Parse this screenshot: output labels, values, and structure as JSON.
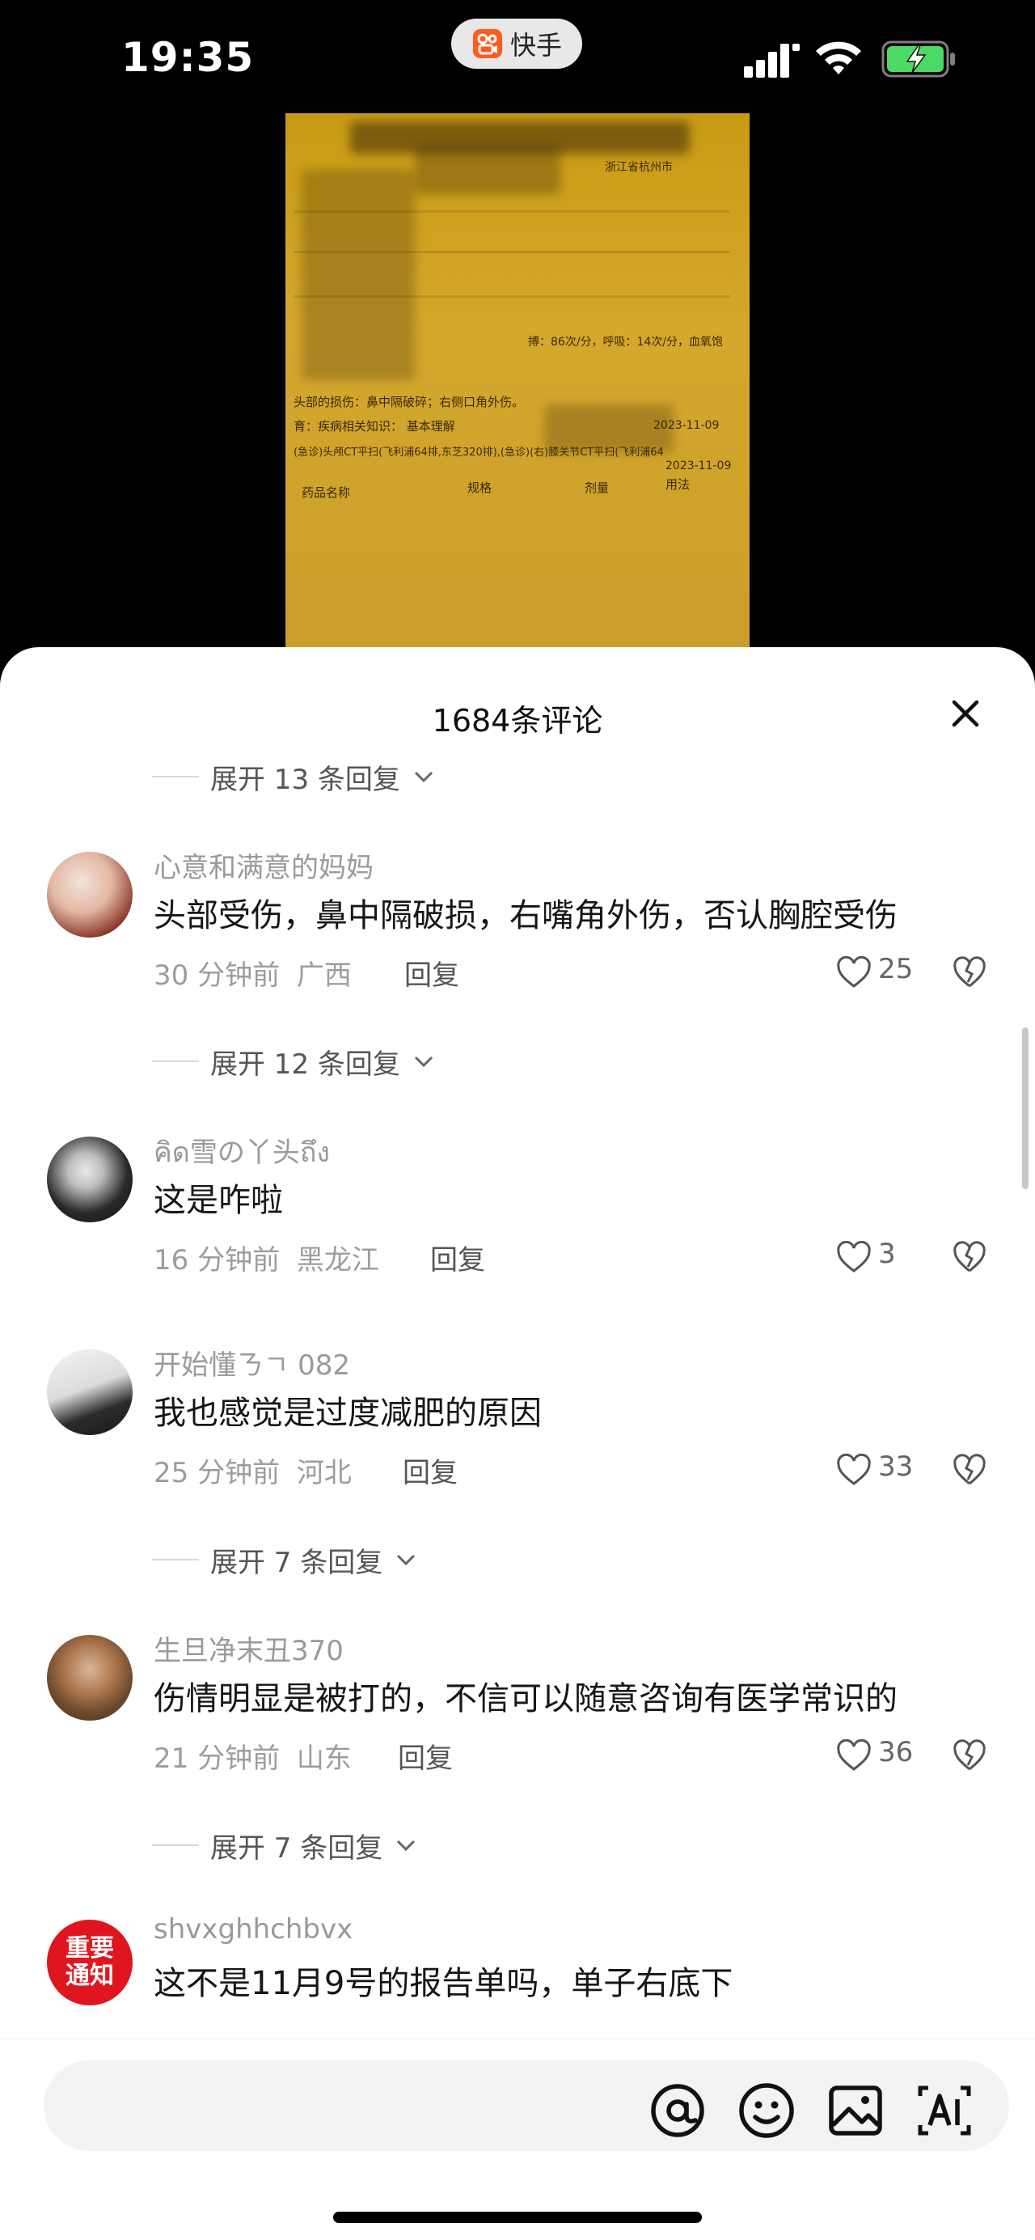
{
  "status_bar": {
    "time": "19:35",
    "app_name": "快手",
    "signal_icon": "cellular-signal-icon",
    "wifi_icon": "wifi-icon",
    "battery_icon": "battery-charging-icon",
    "battery_color": "#4cd964"
  },
  "sheet": {
    "title": "1684条评论"
  },
  "expanders": [
    {
      "label": "展开 13 条回复"
    },
    {
      "label": "展开 12 条回复"
    },
    {
      "label": "展开 7 条回复"
    },
    {
      "label": "展开 7 条回复"
    }
  ],
  "comments": [
    {
      "user": "心意和满意的妈妈",
      "text": "头部受伤，鼻中隔破损，右嘴角外伤，否认胸腔受伤",
      "time": "30 分钟前",
      "location": "广西",
      "reply_label": "回复",
      "likes": "25"
    },
    {
      "user": "คิด雪の丫头ถึง",
      "text": "这是咋啦",
      "time": "16 分钟前",
      "location": "黑龙江",
      "reply_label": "回复",
      "likes": "3"
    },
    {
      "user": "开始懂ㄋㄱ 082",
      "text": "我也感觉是过度减肥的原因",
      "time": "25 分钟前",
      "location": "河北",
      "reply_label": "回复",
      "likes": "33"
    },
    {
      "user": "生旦净末丑370",
      "text": "伤情明显是被打的，不信可以随意咨询有医学常识的",
      "time": "21 分钟前",
      "location": "山东",
      "reply_label": "回复",
      "likes": "36"
    },
    {
      "user": "shvxghhchbvx",
      "text": "这不是11月9号的报告单吗，单子右底下",
      "avatar_badge": [
        "重要",
        "通知"
      ]
    }
  ],
  "document_snippets": {
    "date1": "2023-11-09",
    "date2": "2023-11-09",
    "line_ct": "(急诊)头颅CT平扫(飞利浦64排,东芝320排),(急诊)(右)膝关节CT平扫(飞利浦64",
    "col_drug": "药品名称",
    "col_spec": "规格",
    "col_dose": "剂量",
    "col_usage": "用法",
    "diag_text": "头部的损伤：鼻中隔破碎；右侧口角外伤。",
    "edu_text": "育：疾病相关知识： 基本理解",
    "location_text": "浙江省杭州市",
    "vitals": "搏：86次/分，呼吸：14次/分，血氧饱"
  },
  "input_bar": {
    "placeholder": "",
    "mention_icon": "at-sign-icon",
    "emoji_icon": "smiley-icon",
    "image_icon": "image-icon",
    "ai_icon": "ai-text-icon"
  }
}
